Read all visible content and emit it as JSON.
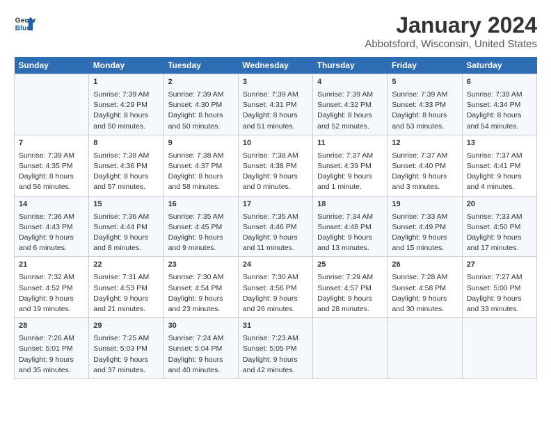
{
  "header": {
    "logo_line1": "General",
    "logo_line2": "Blue",
    "title": "January 2024",
    "subtitle": "Abbotsford, Wisconsin, United States"
  },
  "columns": [
    "Sunday",
    "Monday",
    "Tuesday",
    "Wednesday",
    "Thursday",
    "Friday",
    "Saturday"
  ],
  "weeks": [
    [
      {
        "day": "",
        "content": ""
      },
      {
        "day": "1",
        "content": "Sunrise: 7:39 AM\nSunset: 4:29 PM\nDaylight: 8 hours\nand 50 minutes."
      },
      {
        "day": "2",
        "content": "Sunrise: 7:39 AM\nSunset: 4:30 PM\nDaylight: 8 hours\nand 50 minutes."
      },
      {
        "day": "3",
        "content": "Sunrise: 7:39 AM\nSunset: 4:31 PM\nDaylight: 8 hours\nand 51 minutes."
      },
      {
        "day": "4",
        "content": "Sunrise: 7:39 AM\nSunset: 4:32 PM\nDaylight: 8 hours\nand 52 minutes."
      },
      {
        "day": "5",
        "content": "Sunrise: 7:39 AM\nSunset: 4:33 PM\nDaylight: 8 hours\nand 53 minutes."
      },
      {
        "day": "6",
        "content": "Sunrise: 7:39 AM\nSunset: 4:34 PM\nDaylight: 8 hours\nand 54 minutes."
      }
    ],
    [
      {
        "day": "7",
        "content": "Sunrise: 7:39 AM\nSunset: 4:35 PM\nDaylight: 8 hours\nand 56 minutes."
      },
      {
        "day": "8",
        "content": "Sunrise: 7:38 AM\nSunset: 4:36 PM\nDaylight: 8 hours\nand 57 minutes."
      },
      {
        "day": "9",
        "content": "Sunrise: 7:38 AM\nSunset: 4:37 PM\nDaylight: 8 hours\nand 58 minutes."
      },
      {
        "day": "10",
        "content": "Sunrise: 7:38 AM\nSunset: 4:38 PM\nDaylight: 9 hours\nand 0 minutes."
      },
      {
        "day": "11",
        "content": "Sunrise: 7:37 AM\nSunset: 4:39 PM\nDaylight: 9 hours\nand 1 minute."
      },
      {
        "day": "12",
        "content": "Sunrise: 7:37 AM\nSunset: 4:40 PM\nDaylight: 9 hours\nand 3 minutes."
      },
      {
        "day": "13",
        "content": "Sunrise: 7:37 AM\nSunset: 4:41 PM\nDaylight: 9 hours\nand 4 minutes."
      }
    ],
    [
      {
        "day": "14",
        "content": "Sunrise: 7:36 AM\nSunset: 4:43 PM\nDaylight: 9 hours\nand 6 minutes."
      },
      {
        "day": "15",
        "content": "Sunrise: 7:36 AM\nSunset: 4:44 PM\nDaylight: 9 hours\nand 8 minutes."
      },
      {
        "day": "16",
        "content": "Sunrise: 7:35 AM\nSunset: 4:45 PM\nDaylight: 9 hours\nand 9 minutes."
      },
      {
        "day": "17",
        "content": "Sunrise: 7:35 AM\nSunset: 4:46 PM\nDaylight: 9 hours\nand 11 minutes."
      },
      {
        "day": "18",
        "content": "Sunrise: 7:34 AM\nSunset: 4:48 PM\nDaylight: 9 hours\nand 13 minutes."
      },
      {
        "day": "19",
        "content": "Sunrise: 7:33 AM\nSunset: 4:49 PM\nDaylight: 9 hours\nand 15 minutes."
      },
      {
        "day": "20",
        "content": "Sunrise: 7:33 AM\nSunset: 4:50 PM\nDaylight: 9 hours\nand 17 minutes."
      }
    ],
    [
      {
        "day": "21",
        "content": "Sunrise: 7:32 AM\nSunset: 4:52 PM\nDaylight: 9 hours\nand 19 minutes."
      },
      {
        "day": "22",
        "content": "Sunrise: 7:31 AM\nSunset: 4:53 PM\nDaylight: 9 hours\nand 21 minutes."
      },
      {
        "day": "23",
        "content": "Sunrise: 7:30 AM\nSunset: 4:54 PM\nDaylight: 9 hours\nand 23 minutes."
      },
      {
        "day": "24",
        "content": "Sunrise: 7:30 AM\nSunset: 4:56 PM\nDaylight: 9 hours\nand 26 minutes."
      },
      {
        "day": "25",
        "content": "Sunrise: 7:29 AM\nSunset: 4:57 PM\nDaylight: 9 hours\nand 28 minutes."
      },
      {
        "day": "26",
        "content": "Sunrise: 7:28 AM\nSunset: 4:58 PM\nDaylight: 9 hours\nand 30 minutes."
      },
      {
        "day": "27",
        "content": "Sunrise: 7:27 AM\nSunset: 5:00 PM\nDaylight: 9 hours\nand 33 minutes."
      }
    ],
    [
      {
        "day": "28",
        "content": "Sunrise: 7:26 AM\nSunset: 5:01 PM\nDaylight: 9 hours\nand 35 minutes."
      },
      {
        "day": "29",
        "content": "Sunrise: 7:25 AM\nSunset: 5:03 PM\nDaylight: 9 hours\nand 37 minutes."
      },
      {
        "day": "30",
        "content": "Sunrise: 7:24 AM\nSunset: 5:04 PM\nDaylight: 9 hours\nand 40 minutes."
      },
      {
        "day": "31",
        "content": "Sunrise: 7:23 AM\nSunset: 5:05 PM\nDaylight: 9 hours\nand 42 minutes."
      },
      {
        "day": "",
        "content": ""
      },
      {
        "day": "",
        "content": ""
      },
      {
        "day": "",
        "content": ""
      }
    ]
  ]
}
